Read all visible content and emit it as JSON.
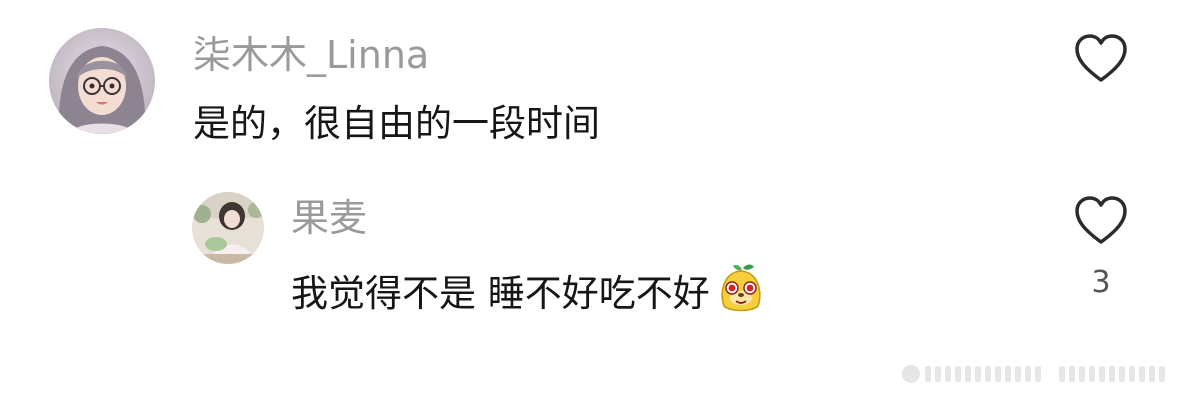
{
  "comments": [
    {
      "username": "柒木木_Linna",
      "text": "是的，很自由的一段时间",
      "likes": ""
    },
    {
      "username": "果麦",
      "text": "我觉得不是 睡不好吃不好",
      "likes": "3"
    }
  ],
  "icons": {
    "like": "heart-outline-icon",
    "emoji": "yellow-mascot-emoji"
  }
}
